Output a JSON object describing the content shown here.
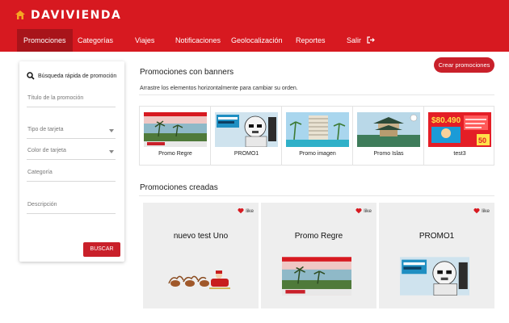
{
  "brand": {
    "name": "DAVIVIENDA",
    "color": "#d71920"
  },
  "nav": {
    "items": [
      {
        "label": "Promociones",
        "active": true
      },
      {
        "label": "Categorías",
        "active": false
      },
      {
        "label": "Viajes",
        "active": false
      },
      {
        "label": "Notificaciones",
        "active": false
      },
      {
        "label": "Geolocalización",
        "active": false
      },
      {
        "label": "Reportes",
        "active": false
      },
      {
        "label": "Salir",
        "active": false,
        "icon": "logout-icon"
      }
    ]
  },
  "sidebar": {
    "search_title": "Búsqueda rápida de promoción",
    "fields": [
      {
        "label": "Título de la promoción",
        "type": "text"
      },
      {
        "label": "Tipo de tarjeta",
        "type": "select"
      },
      {
        "label": "Color de tarjeta",
        "type": "select"
      },
      {
        "label": "Categoría",
        "type": "text"
      },
      {
        "label": "Descripción",
        "type": "text"
      }
    ],
    "search_button": "BUSCAR"
  },
  "banners": {
    "title": "Promociones con banners",
    "hint": "Arrastre los elementos horizontalmente para cambiar su orden.",
    "create_button": "Crear promociones",
    "items": [
      {
        "label": "Promo Regre",
        "image": "beach-resort-image"
      },
      {
        "label": "PROMO1",
        "image": "stormtrooper-image"
      },
      {
        "label": "Promo imagen",
        "image": "hotel-pool-image"
      },
      {
        "label": "Promo Islas",
        "image": "pagoda-image"
      },
      {
        "label": "test3",
        "image": "sale-ad-image",
        "price": "$80.490",
        "badge": "50"
      }
    ]
  },
  "created": {
    "title": "Promociones creadas",
    "like_label": "like",
    "items": [
      {
        "title": "nuevo test Uno",
        "image": "santa-sleigh-image"
      },
      {
        "title": "Promo Regre",
        "image": "beach-resort-image"
      },
      {
        "title": "PROMO1",
        "image": "stormtrooper-image"
      }
    ]
  }
}
